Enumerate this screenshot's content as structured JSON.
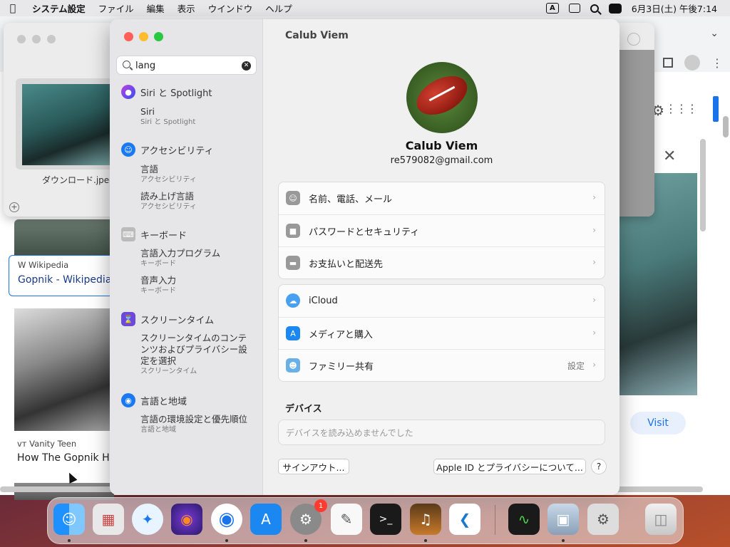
{
  "menubar": {
    "app_name": "システム設定",
    "items": [
      "ファイル",
      "編集",
      "表示",
      "ウインドウ",
      "ヘルプ"
    ],
    "ime_indicator": "A",
    "datetime": "6月3日(土) 午後7:14"
  },
  "browser": {
    "results": [
      {
        "source": "Wikipedia",
        "title": "Gopnik - Wikipedia"
      },
      {
        "source": "Vanity Teen",
        "title": "How The Gopnik Hav"
      }
    ],
    "visit_label": "Visit"
  },
  "preview": {
    "filename": "ダウンロード.jpeg"
  },
  "settings": {
    "search": {
      "value": "lang"
    },
    "sidebar": [
      {
        "category": "Siri と Spotlight",
        "icon": "siri-icon",
        "items": [
          {
            "title": "Siri",
            "subtitle": "Siri と Spotlight"
          }
        ]
      },
      {
        "category": "アクセシビリティ",
        "icon": "accessibility-icon",
        "items": [
          {
            "title": "言語",
            "subtitle": "アクセシビリティ"
          },
          {
            "title": "読み上げ言語",
            "subtitle": "アクセシビリティ"
          }
        ]
      },
      {
        "category": "キーボード",
        "icon": "keyboard-icon",
        "items": [
          {
            "title": "言語入力プログラム",
            "subtitle": "キーボード"
          },
          {
            "title": "音声入力",
            "subtitle": "キーボード"
          }
        ]
      },
      {
        "category": "スクリーンタイム",
        "icon": "hourglass-icon",
        "items": [
          {
            "title": "スクリーンタイムのコンテンツおよびプライバシー設定を選択",
            "subtitle": "スクリーンタイム"
          }
        ]
      },
      {
        "category": "言語と地域",
        "icon": "globe-icon",
        "items": [
          {
            "title": "言語の環境設定と優先順位",
            "subtitle": "言語と地域"
          }
        ]
      }
    ],
    "header": "Calub Viem",
    "account": {
      "name": "Calub Viem",
      "email": "re579082@gmail.com"
    },
    "group1": [
      {
        "label": "名前、電話、メール",
        "icon": "contact-icon"
      },
      {
        "label": "パスワードとセキュリティ",
        "icon": "lock-icon"
      },
      {
        "label": "お支払いと配送先",
        "icon": "card-icon"
      }
    ],
    "group2": [
      {
        "label": "iCloud",
        "icon": "icloud-icon",
        "value": ""
      },
      {
        "label": "メディアと購入",
        "icon": "appstore-icon",
        "value": ""
      },
      {
        "label": "ファミリー共有",
        "icon": "family-icon",
        "value": "設定"
      }
    ],
    "devices_label": "デバイス",
    "devices_message": "デバイスを読み込めませんでした",
    "signout_label": "サインアウト...",
    "about_label": "Apple ID とプライバシーについて...",
    "help_label": "?"
  },
  "dock": {
    "apps": [
      "finder-icon",
      "launchpad-icon",
      "safari-icon",
      "firefox-icon",
      "chrome-icon",
      "appstore-icon",
      "system-settings-icon",
      "textedit-icon",
      "terminal-icon",
      "garageband-icon",
      "vscode-icon",
      "activity-monitor-icon",
      "preview-icon",
      "migration-icon",
      "trash-icon"
    ],
    "settings_badge": "1"
  }
}
